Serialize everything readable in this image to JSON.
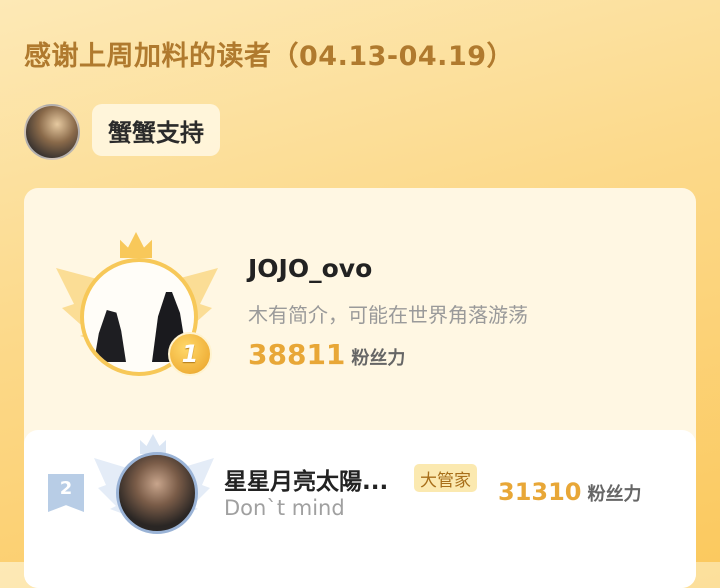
{
  "header": {
    "title": "感谢上周加料的读者（04.13-04.19）"
  },
  "sponsor": {
    "label": "蟹蟹支持"
  },
  "ranking": {
    "first": {
      "rank": "1",
      "name": "JOJO_ovo",
      "description": "木有简介，可能在世界角落游荡",
      "fans": "38811",
      "fans_unit": "粉丝力"
    },
    "second": {
      "rank": "2",
      "name": "星星月亮太陽...",
      "badge": "大管家",
      "description": "Don`t mind",
      "fans": "31310",
      "fans_unit": "粉丝力"
    }
  },
  "colors": {
    "accent": "#e8a737",
    "header_text": "#b07a2e",
    "gold": "#f7c858",
    "silver": "#9ab3d6"
  }
}
